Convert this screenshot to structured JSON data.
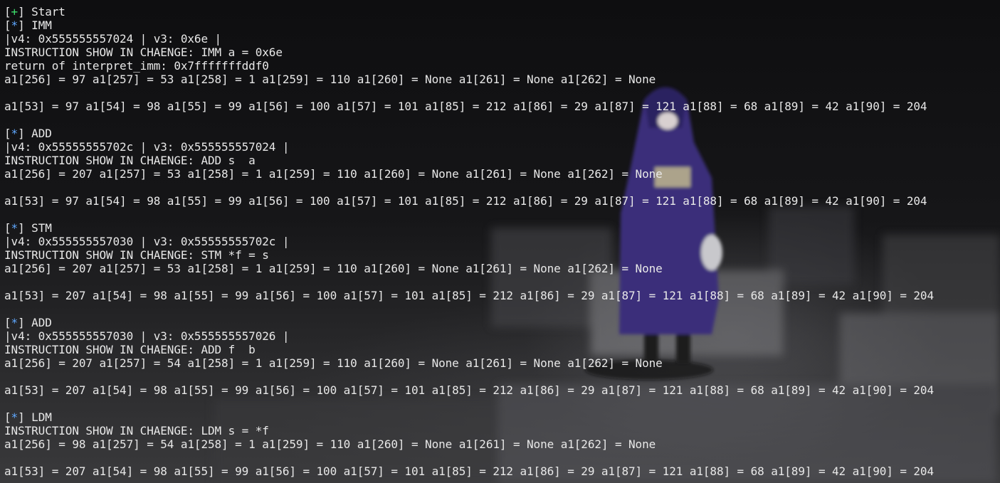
{
  "terminal": {
    "lines": [
      {
        "type": "marker",
        "symbol": "+",
        "text": "Start"
      },
      {
        "type": "marker",
        "symbol": "*",
        "text": "IMM"
      },
      {
        "type": "text",
        "text": "|v4: 0x555555557024 | v3: 0x6e |"
      },
      {
        "type": "text",
        "text": "INSTRUCTION SHOW IN CHAENGE: IMM a = 0x6e"
      },
      {
        "type": "text",
        "text": "return of interpret_imm: 0x7fffffffddf0"
      },
      {
        "type": "text",
        "text": "a1[256] = 97 a1[257] = 53 a1[258] = 1 a1[259] = 110 a1[260] = None a1[261] = None a1[262] = None"
      },
      {
        "type": "text",
        "text": ""
      },
      {
        "type": "text",
        "text": "a1[53] = 97 a1[54] = 98 a1[55] = 99 a1[56] = 100 a1[57] = 101 a1[85] = 212 a1[86] = 29 a1[87] = 121 a1[88] = 68 a1[89] = 42 a1[90] = 204"
      },
      {
        "type": "text",
        "text": ""
      },
      {
        "type": "marker",
        "symbol": "*",
        "text": "ADD"
      },
      {
        "type": "text",
        "text": "|v4: 0x55555555702c | v3: 0x555555557024 |"
      },
      {
        "type": "text",
        "text": "INSTRUCTION SHOW IN CHAENGE: ADD s  a"
      },
      {
        "type": "text",
        "text": "a1[256] = 207 a1[257] = 53 a1[258] = 1 a1[259] = 110 a1[260] = None a1[261] = None a1[262] = None"
      },
      {
        "type": "text",
        "text": ""
      },
      {
        "type": "text",
        "text": "a1[53] = 97 a1[54] = 98 a1[55] = 99 a1[56] = 100 a1[57] = 101 a1[85] = 212 a1[86] = 29 a1[87] = 121 a1[88] = 68 a1[89] = 42 a1[90] = 204"
      },
      {
        "type": "text",
        "text": ""
      },
      {
        "type": "marker",
        "symbol": "*",
        "text": "STM"
      },
      {
        "type": "text",
        "text": "|v4: 0x555555557030 | v3: 0x55555555702c |"
      },
      {
        "type": "text",
        "text": "INSTRUCTION SHOW IN CHAENGE: STM *f = s"
      },
      {
        "type": "text",
        "text": "a1[256] = 207 a1[257] = 53 a1[258] = 1 a1[259] = 110 a1[260] = None a1[261] = None a1[262] = None"
      },
      {
        "type": "text",
        "text": ""
      },
      {
        "type": "text",
        "text": "a1[53] = 207 a1[54] = 98 a1[55] = 99 a1[56] = 100 a1[57] = 101 a1[85] = 212 a1[86] = 29 a1[87] = 121 a1[88] = 68 a1[89] = 42 a1[90] = 204"
      },
      {
        "type": "text",
        "text": ""
      },
      {
        "type": "marker",
        "symbol": "*",
        "text": "ADD"
      },
      {
        "type": "text",
        "text": "|v4: 0x555555557030 | v3: 0x555555557026 |"
      },
      {
        "type": "text",
        "text": "INSTRUCTION SHOW IN CHAENGE: ADD f  b"
      },
      {
        "type": "text",
        "text": "a1[256] = 207 a1[257] = 54 a1[258] = 1 a1[259] = 110 a1[260] = None a1[261] = None a1[262] = None"
      },
      {
        "type": "text",
        "text": ""
      },
      {
        "type": "text",
        "text": "a1[53] = 207 a1[54] = 98 a1[55] = 99 a1[56] = 100 a1[57] = 101 a1[85] = 212 a1[86] = 29 a1[87] = 121 a1[88] = 68 a1[89] = 42 a1[90] = 204"
      },
      {
        "type": "text",
        "text": ""
      },
      {
        "type": "marker",
        "symbol": "*",
        "text": "LDM"
      },
      {
        "type": "text",
        "text": "INSTRUCTION SHOW IN CHAENGE: LDM s = *f"
      },
      {
        "type": "text",
        "text": "a1[256] = 98 a1[257] = 54 a1[258] = 1 a1[259] = 110 a1[260] = None a1[261] = None a1[262] = None"
      },
      {
        "type": "text",
        "text": ""
      },
      {
        "type": "text",
        "text": "a1[53] = 207 a1[54] = 98 a1[55] = 99 a1[56] = 100 a1[57] = 101 a1[85] = 212 a1[86] = 29 a1[87] = 121 a1[88] = 68 a1[89] = 42 a1[90] = 204"
      }
    ]
  },
  "colors": {
    "text": "#e8e8e8",
    "plus_marker": "#3ddc6b",
    "star_marker": "#5fa8ff",
    "background": "#0b0b0c"
  }
}
